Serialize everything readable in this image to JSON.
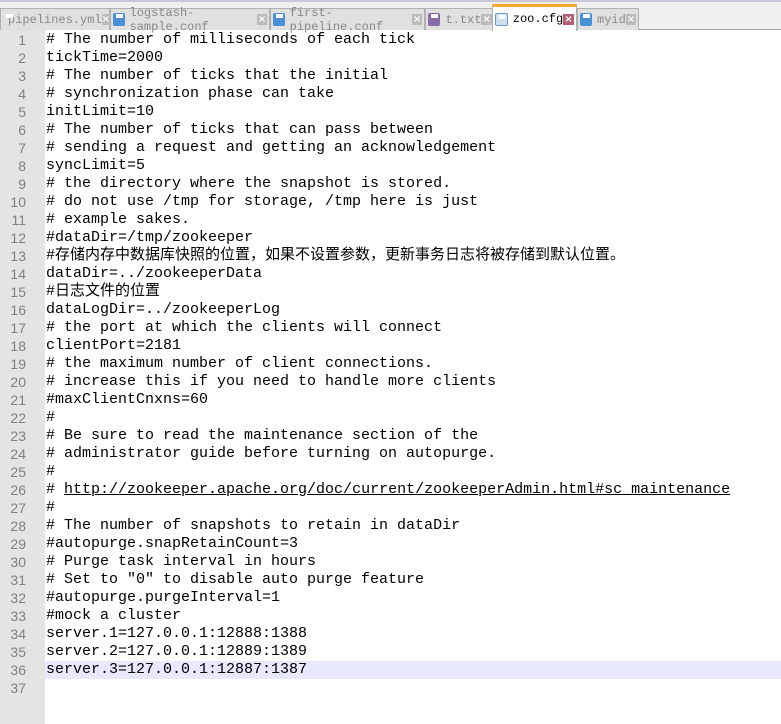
{
  "tabs": [
    {
      "label": "pipelines.yml",
      "icon": "floppy-blue",
      "active": false
    },
    {
      "label": "logstash-sample.conf",
      "icon": "floppy-blue",
      "active": false
    },
    {
      "label": "first-pipeline.conf",
      "icon": "floppy-blue",
      "active": false
    },
    {
      "label": "t.txt",
      "icon": "floppy-purple",
      "active": false
    },
    {
      "label": "zoo.cfg",
      "icon": "floppy-blue-unsaved",
      "active": true
    },
    {
      "label": "myid",
      "icon": "floppy-blue",
      "active": false
    }
  ],
  "colors": {
    "active_tab_accent": "#faa83a",
    "current_line": "#e8e8ff",
    "gutter": "#e4e4e4"
  },
  "current_line": 36,
  "lines": [
    "# The number of milliseconds of each tick",
    "tickTime=2000",
    "# The number of ticks that the initial",
    "# synchronization phase can take",
    "initLimit=10",
    "# The number of ticks that can pass between",
    "# sending a request and getting an acknowledgement",
    "syncLimit=5",
    "# the directory where the snapshot is stored.",
    "# do not use /tmp for storage, /tmp here is just",
    "# example sakes.",
    "#dataDir=/tmp/zookeeper",
    "#存储内存中数据库快照的位置，如果不设置参数，更新事务日志将被存储到默认位置。",
    "dataDir=../zookeeperData",
    "#日志文件的位置",
    "dataLogDir=../zookeeperLog",
    "# the port at which the clients will connect",
    "clientPort=2181",
    "# the maximum number of client connections.",
    "# increase this if you need to handle more clients",
    "#maxClientCnxns=60",
    "#",
    "# Be sure to read the maintenance section of the",
    "# administrator guide before turning on autopurge.",
    "#",
    "# http://zookeeper.apache.org/doc/current/zookeeperAdmin.html#sc_maintenance",
    "#",
    "# The number of snapshots to retain in dataDir",
    "#autopurge.snapRetainCount=3",
    "# Purge task interval in hours",
    "# Set to \"0\" to disable auto purge feature",
    "#autopurge.purgeInterval=1",
    "#mock a cluster",
    "server.1=127.0.0.1:12888:1388",
    "server.2=127.0.0.1:12889:1389",
    "server.3=127.0.0.1:12887:1387",
    ""
  ]
}
